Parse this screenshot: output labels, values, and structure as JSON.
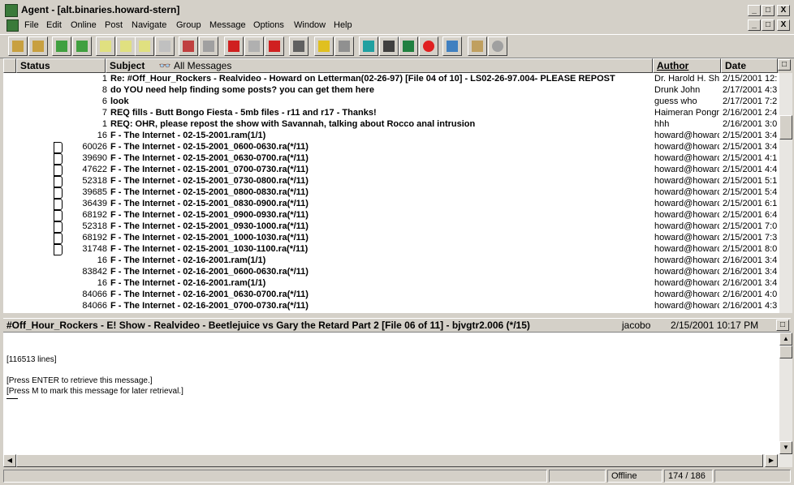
{
  "window": {
    "title": "Agent - [alt.binaries.howard-stern]",
    "min_label": "_",
    "max_label": "□",
    "close_label": "X"
  },
  "menu": [
    "File",
    "Edit",
    "Online",
    "Post",
    "Navigate",
    "Group",
    "Message",
    "Options",
    "Window",
    "Help"
  ],
  "toolbar_icons": [
    "open-group-icon",
    "new-group-icon",
    "get-new-headers-icon",
    "get-all-headers-icon",
    "post-new-icon",
    "reply-icon",
    "follow-up-icon",
    "forward-icon",
    "mark-icon",
    "next-unread-icon",
    "previous-icon",
    "view-icon",
    "rot13-icon",
    "filter-icon",
    "watch-icon",
    "kill-icon",
    "ignore-icon",
    "retrieve-icon",
    "glasses-icon",
    "lock-icon",
    "block-icon",
    "pencil-icon",
    "info-icon",
    "stop-icon"
  ],
  "list": {
    "headers": {
      "status": "Status",
      "subject": "Subject",
      "filter": "All Messages",
      "author": "Author",
      "date": "Date"
    },
    "rows": [
      {
        "lines": "1",
        "subject": "Re: #Off_Hour_Rockers - Realvideo - Howard on Letterman(02-26-97) [File 04 of 10] - LS02-26-97.004- PLEASE REPOST",
        "author": "Dr. Harold H. Shi",
        "date": "2/15/2001 12:",
        "stat": false
      },
      {
        "lines": "8",
        "subject": "do YOU need help finding some posts? you can get them here",
        "author": "Drunk John",
        "date": "2/17/2001 4:3",
        "stat": false
      },
      {
        "lines": "6",
        "subject": "look",
        "author": "guess who",
        "date": "2/17/2001 7:2",
        "stat": false
      },
      {
        "lines": "7",
        "subject": "REQ fills - Butt Bongo Fiesta - 5mb files - r11 and r17 - Thanks!",
        "author": "Haimeran Pongra",
        "date": "2/16/2001 2:4",
        "stat": false
      },
      {
        "lines": "1",
        "subject": "REQ: OHR, please repost the show with Savannah, talking about Rocco anal intrusion",
        "author": "hhh",
        "date": "2/16/2001 3:0",
        "stat": false
      },
      {
        "lines": "16",
        "subject": "F - The Internet - 02-15-2001.ram(1/1)",
        "author": "howard@howarc",
        "date": "2/15/2001 3:4",
        "stat": false
      },
      {
        "lines": "60026",
        "subject": "F - The Internet - 02-15-2001_0600-0630.ra(*/11)",
        "author": "howard@howarc",
        "date": "2/15/2001 3:4",
        "stat": true
      },
      {
        "lines": "39690",
        "subject": "F - The Internet - 02-15-2001_0630-0700.ra(*/11)",
        "author": "howard@howarc",
        "date": "2/15/2001 4:1",
        "stat": true
      },
      {
        "lines": "47622",
        "subject": "F - The Internet - 02-15-2001_0700-0730.ra(*/11)",
        "author": "howard@howarc",
        "date": "2/15/2001 4:4",
        "stat": true
      },
      {
        "lines": "52318",
        "subject": "F - The Internet - 02-15-2001_0730-0800.ra(*/11)",
        "author": "howard@howarc",
        "date": "2/15/2001 5:1",
        "stat": true
      },
      {
        "lines": "39685",
        "subject": "F - The Internet - 02-15-2001_0800-0830.ra(*/11)",
        "author": "howard@howarc",
        "date": "2/15/2001 5:4",
        "stat": true
      },
      {
        "lines": "36439",
        "subject": "F - The Internet - 02-15-2001_0830-0900.ra(*/11)",
        "author": "howard@howarc",
        "date": "2/15/2001 6:1",
        "stat": true
      },
      {
        "lines": "68192",
        "subject": "F - The Internet - 02-15-2001_0900-0930.ra(*/11)",
        "author": "howard@howarc",
        "date": "2/15/2001 6:4",
        "stat": true
      },
      {
        "lines": "52318",
        "subject": "F - The Internet - 02-15-2001_0930-1000.ra(*/11)",
        "author": "howard@howarc",
        "date": "2/15/2001 7:0",
        "stat": true
      },
      {
        "lines": "68192",
        "subject": "F - The Internet - 02-15-2001_1000-1030.ra(*/11)",
        "author": "howard@howarc",
        "date": "2/15/2001 7:3",
        "stat": true
      },
      {
        "lines": "31748",
        "subject": "F - The Internet - 02-15-2001_1030-1100.ra(*/11)",
        "author": "howard@howarc",
        "date": "2/15/2001 8:0",
        "stat": true
      },
      {
        "lines": "16",
        "subject": "F - The Internet - 02-16-2001.ram(1/1)",
        "author": "howard@howarc",
        "date": "2/16/2001 3:4",
        "stat": false
      },
      {
        "lines": "83842",
        "subject": "F - The Internet - 02-16-2001_0600-0630.ra(*/11)",
        "author": "howard@howarc",
        "date": "2/16/2001 3:4",
        "stat": false
      },
      {
        "lines": "16",
        "subject": "F - The Internet - 02-16-2001.ram(1/1)",
        "author": "howard@howarc",
        "date": "2/16/2001 3:4",
        "stat": false
      },
      {
        "lines": "84066",
        "subject": "F - The Internet - 02-16-2001_0630-0700.ra(*/11)",
        "author": "howard@howarc",
        "date": "2/16/2001 4:0",
        "stat": false
      },
      {
        "lines": "84066",
        "subject": "F - The Internet - 02-16-2001_0700-0730.ra(*/11)",
        "author": "howard@howarc",
        "date": "2/16/2001 4:3",
        "stat": false
      }
    ]
  },
  "preview": {
    "subject": "#Off_Hour_Rockers - E! Show - Realvideo - Beetlejuice vs Gary the Retard Part 2 [File 06 of 11] - bjvgtr2.006 (*/15)",
    "author": "jacobo",
    "date": "2/15/2001 10:17 PM",
    "lines": "[116513 lines]",
    "msg1": "[Press ENTER to retrieve this message.]",
    "msg2": "[Press M to mark this message for later retrieval.]"
  },
  "status": {
    "connection": "Offline",
    "position": "174 / 186"
  }
}
